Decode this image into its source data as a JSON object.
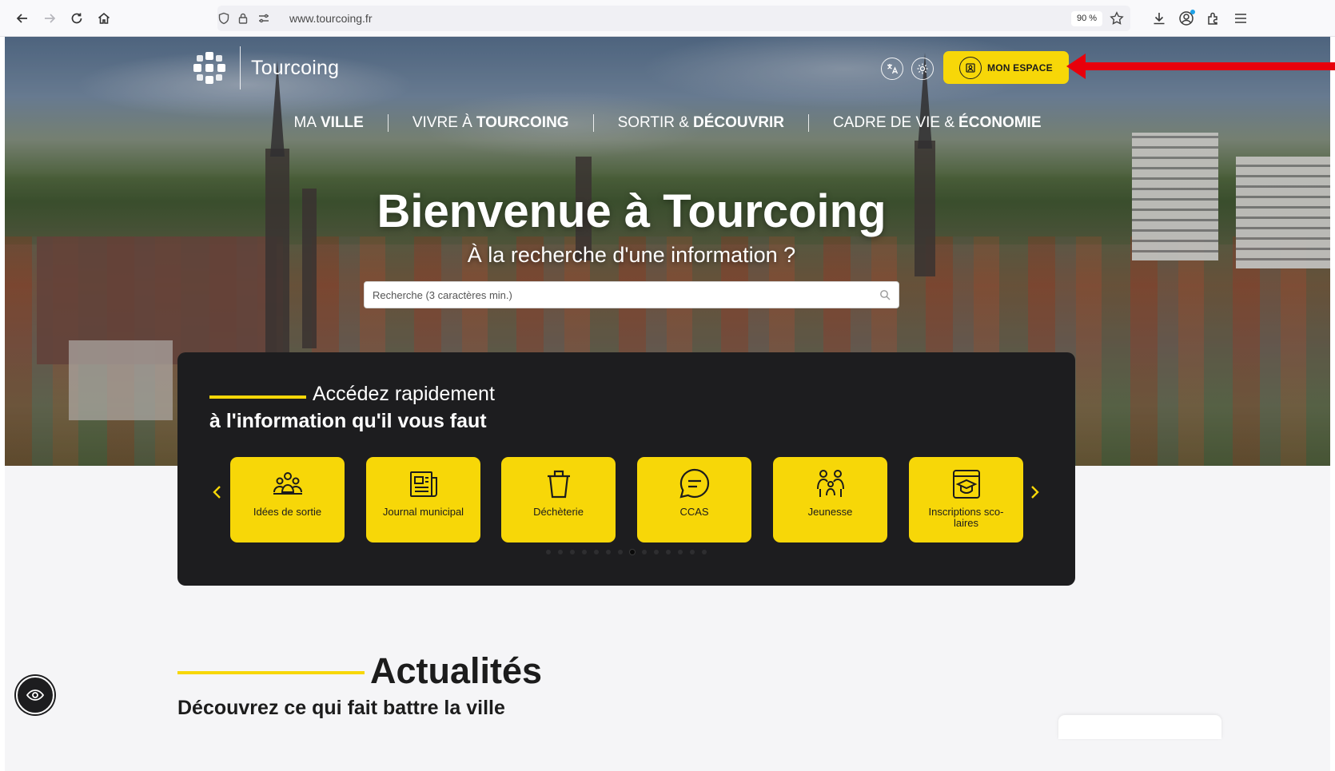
{
  "browser": {
    "url": "www.tourcoing.fr",
    "zoom": "90 %",
    "icons": [
      "back-icon",
      "forward-icon",
      "reload-icon",
      "home-icon",
      "shield-icon",
      "lock-icon",
      "permissions-icon",
      "bookmark-star-icon",
      "download-icon",
      "account-icon",
      "extensions-icon",
      "menu-icon"
    ]
  },
  "header": {
    "logo_text": "Tourcoing",
    "mon_espace": "MON ESPACE"
  },
  "nav": {
    "items": [
      {
        "plain": "MA",
        "bold": "VILLE"
      },
      {
        "plain": "VIVRE À",
        "bold": "TOURCOING"
      },
      {
        "plain": "SORTIR &",
        "bold": "DÉCOUVRIR"
      },
      {
        "plain": "CADRE DE VIE &",
        "bold": "ÉCONOMIE"
      }
    ]
  },
  "hero": {
    "title": "Bienvenue à Tourcoing",
    "subtitle": "À la recherche d'une information ?",
    "search_placeholder": "Recherche (3 caractères min.)"
  },
  "quick_access": {
    "title_line1": "Accédez rapidement",
    "title_line2": "à l'information qu'il vous faut",
    "tiles": [
      {
        "label": "Idées de sortie",
        "icon": "people-group-icon"
      },
      {
        "label": "Journal municipal",
        "icon": "newspaper-icon"
      },
      {
        "label": "Déchèterie",
        "icon": "trash-bin-icon"
      },
      {
        "label": "CCAS",
        "icon": "chat-bubble-icon"
      },
      {
        "label": "Jeunesse",
        "icon": "family-icon"
      },
      {
        "label": "Inscriptions sco-\nlaires",
        "icon": "school-cap-icon"
      }
    ],
    "carousel_dot_count": 14,
    "carousel_active_index": 7
  },
  "news": {
    "title": "Actualités",
    "subtitle": "Découvrez ce qui fait battre la ville"
  },
  "colors": {
    "accent_yellow": "#f7d708",
    "panel_dark": "#1d1d1f",
    "annotation_red": "#e8000b"
  }
}
